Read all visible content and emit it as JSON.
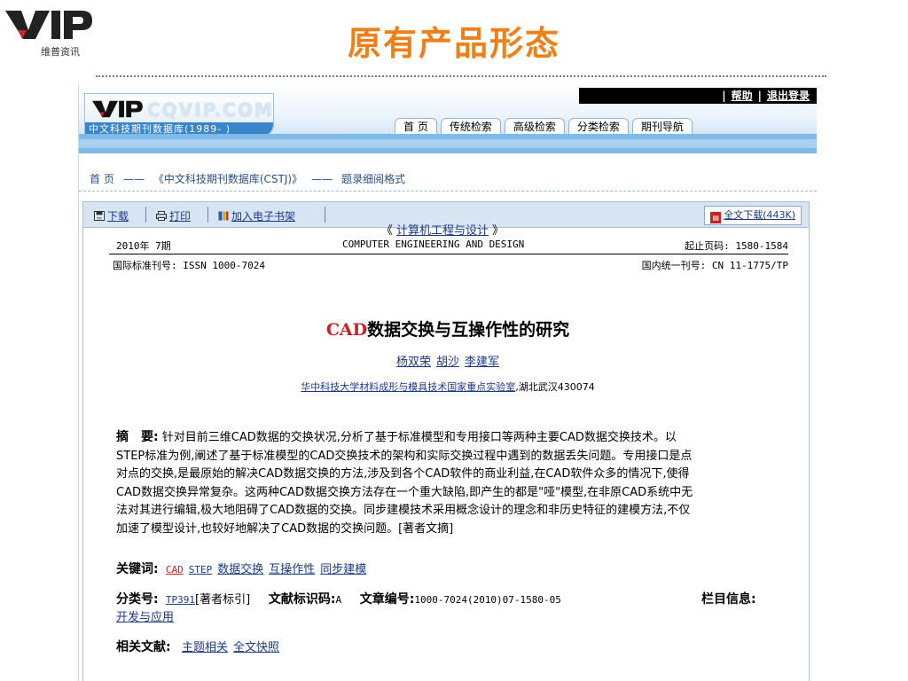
{
  "slide": {
    "title": "原有产品形态",
    "logo_text": "维普资讯"
  },
  "banner": {
    "links": [
      "帮助",
      "退出登录"
    ],
    "brand_watermark": "CQVIP.COM",
    "brand_strip": "中文科技期刊数据库(1989- )",
    "tabs": [
      "首 页",
      "传统检索",
      "高级检索",
      "分类检索",
      "期刊导航"
    ]
  },
  "breadcrumb": [
    "首 页",
    "——",
    "《中文科技期刊数据库(CSTJ)》",
    "——",
    "题录细阅格式"
  ],
  "toolbar": {
    "download": "下载",
    "print": "打印",
    "bookshelf": "加入电子书架",
    "fulltext": "全文下载(443K)"
  },
  "journal": {
    "name_cn": "计算机工程与设计",
    "left_bracket": "《",
    "right_bracket": "》",
    "issue": "2010年 7期",
    "name_en": "COMPUTER ENGINEERING AND DESIGN",
    "pages": "起止页码: 1580-1584",
    "issn": "国际标准刊号: ISSN 1000-7024",
    "cn": "国内统一刊号: CN 11-1775/TP"
  },
  "paper": {
    "title_prefix": "CAD",
    "title_rest": "数据交换与互操作性的研究",
    "authors": [
      "杨双荣",
      "胡沙",
      "李建军"
    ],
    "affiliation_link": "华中科技大学材料成形与模具技术国家重点实验室",
    "affiliation_rest": ",湖北武汉430074"
  },
  "abstract": {
    "label": "摘　要:",
    "lines": [
      "针对目前三维CAD数据的交换状况,分析了基于标准模型和专用接口等两种主要CAD数据交换技术。以",
      "STEP标准为例,阐述了基于标准模型的CAD交换技术的架构和实际交换过程中遇到的数据丢失问题。专用接口是点",
      "对点的交换,是最原始的解决CAD数据交换的方法,涉及到各个CAD软件的商业利益,在CAD软件众多的情况下,使得",
      "CAD数据交换异常复杂。这两种CAD数据交换方法存在一个重大缺陷,即产生的都是\"哑\"模型,在非原CAD系统中无",
      "法对其进行编辑,极大地阻碍了CAD数据的交换。同步建模技术采用概念设计的理念和非历史特征的建模方法,不仅",
      "加速了模型设计,也较好地解决了CAD数据的交换问题。[著者文摘]"
    ]
  },
  "keywords": {
    "label": "关键词:",
    "items": [
      "CAD",
      "STEP",
      "数据交换",
      "互操作性",
      "同步建模"
    ]
  },
  "classification": {
    "label": "分类号:",
    "code": "TP391",
    "code_note": "[著者标引]",
    "doc_id_label": "文献标识码:",
    "doc_id": "A",
    "article_no_label": "文章编号:",
    "article_no": "1000-7024(2010)07-1580-05",
    "column_label": "栏目信息:",
    "column_value": "开发与应用"
  },
  "related": {
    "label": "相关文献:",
    "items": [
      "主题相关",
      "全文快照"
    ]
  }
}
